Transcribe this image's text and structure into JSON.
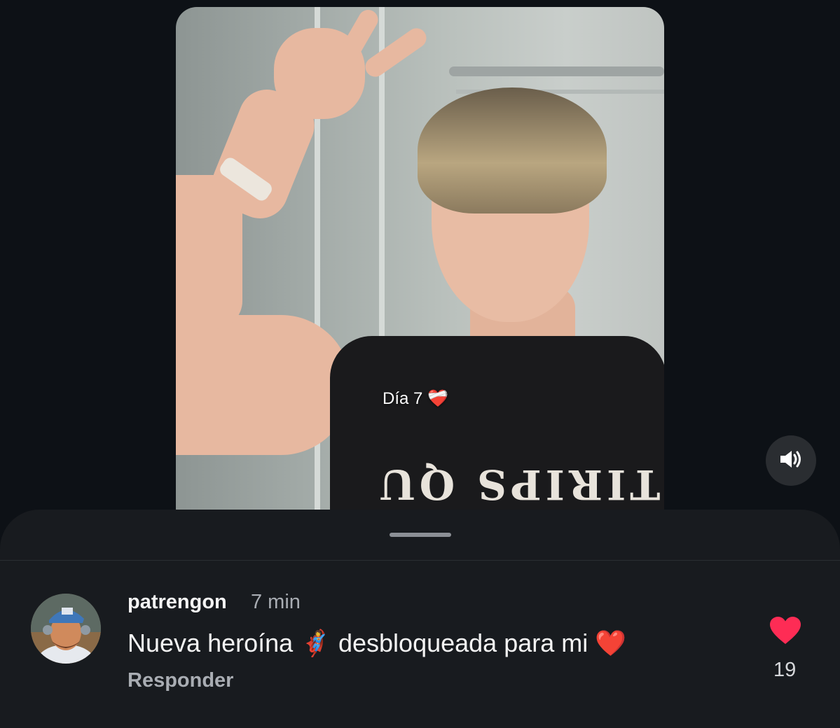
{
  "video": {
    "caption": "Día 7 ❤️‍🩹",
    "shirt_print": "TIRIPS QU"
  },
  "comment": {
    "username": "patrengon",
    "time": "7 min",
    "text": "Nueva heroína 🦸‍♀️ desbloqueada para mi ❤️",
    "reply_label": "Responder",
    "like_count": "19",
    "like_color": "#fe2c55"
  },
  "icons": {
    "sound": "speaker-volume-icon",
    "like": "heart-icon"
  }
}
